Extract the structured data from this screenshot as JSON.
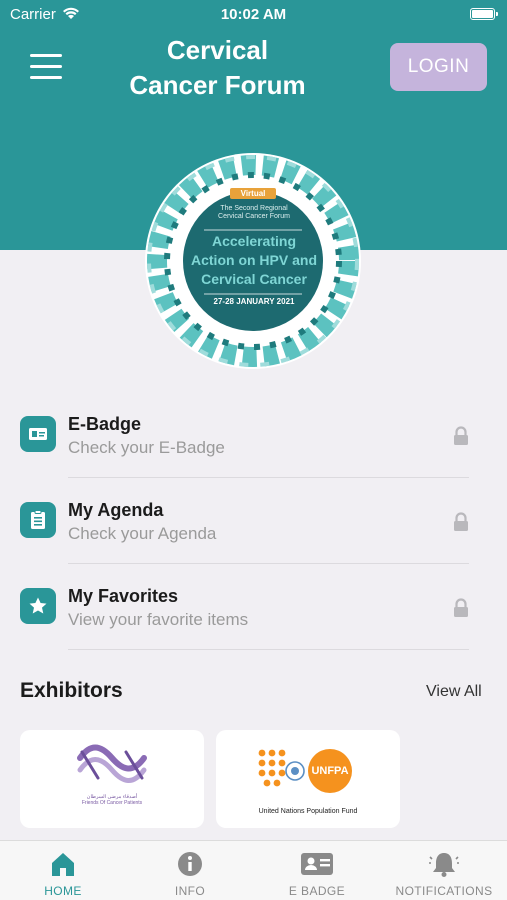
{
  "status_bar": {
    "carrier": "Carrier",
    "time": "10:02 AM"
  },
  "header": {
    "title_line1": "Cervical",
    "title_line2": "Cancer Forum",
    "login_label": "LOGIN",
    "background_color": "#2a9698"
  },
  "event_logo": {
    "tag": "Virtual",
    "subtitle_line1": "The Second Regional",
    "subtitle_line2": "Cervical Cancer Forum",
    "main_line1": "Accelerating",
    "main_line2": "Action on HPV and",
    "main_line3": "Cervical Cancer",
    "dates": "27-28 JANUARY 2021"
  },
  "menu_items": [
    {
      "title": "E-Badge",
      "subtitle": "Check your E-Badge",
      "icon": "id-card-icon"
    },
    {
      "title": "My Agenda",
      "subtitle": "Check your Agenda",
      "icon": "clipboard-icon"
    },
    {
      "title": "My Favorites",
      "subtitle": "View your favorite items",
      "icon": "star-icon"
    }
  ],
  "exhibitors": {
    "title": "Exhibitors",
    "view_all": "View All",
    "cards": [
      {
        "arabic_name": "أصدقاء مرضى السرطان",
        "caption": "Friends Of Cancer Patients"
      },
      {
        "logo_text": "UNFPA",
        "caption": "United Nations Population Fund"
      }
    ]
  },
  "tabbar": {
    "tabs": [
      {
        "label": "HOME",
        "icon": "home-icon",
        "active": true
      },
      {
        "label": "INFO",
        "icon": "info-icon",
        "active": false
      },
      {
        "label": "E BADGE",
        "icon": "id-card-icon",
        "active": false
      },
      {
        "label": "NOTIFICATIONS",
        "icon": "bell-icon",
        "active": false
      }
    ]
  },
  "colors": {
    "accent": "#2a9698",
    "login_button": "#c5b4dc",
    "background": "#f1eff3"
  }
}
